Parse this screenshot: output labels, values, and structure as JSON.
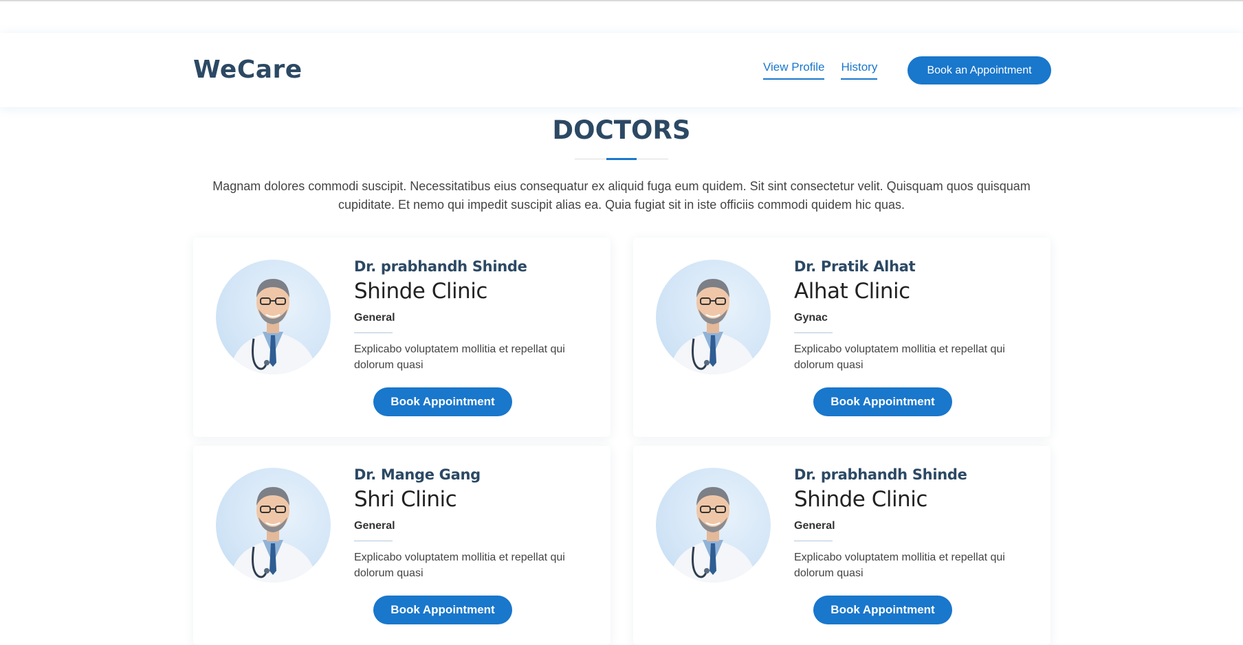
{
  "header": {
    "logo": "WeCare",
    "nav": [
      "View Profile",
      "History"
    ],
    "cta": "Book an Appointment"
  },
  "section": {
    "title": "DOCTORS",
    "description": "Magnam dolores commodi suscipit. Necessitatibus eius consequatur ex aliquid fuga eum quidem. Sit sint consectetur velit. Quisquam quos quisquam cupiditate. Et nemo qui impedit suscipit alias ea. Quia fugiat sit in iste officiis commodi quidem hic quas."
  },
  "doctors": [
    {
      "name": "Dr. prabhandh Shinde",
      "clinic": "Shinde Clinic",
      "specialty": "General",
      "description": "Explicabo voluptatem mollitia et repellat qui dolorum quasi",
      "button": "Book Appointment"
    },
    {
      "name": "Dr. Pratik Alhat",
      "clinic": "Alhat Clinic",
      "specialty": "Gynac",
      "description": "Explicabo voluptatem mollitia et repellat qui dolorum quasi",
      "button": "Book Appointment"
    },
    {
      "name": "Dr. Mange Gang",
      "clinic": "Shri Clinic",
      "specialty": "General",
      "description": "Explicabo voluptatem mollitia et repellat qui dolorum quasi",
      "button": "Book Appointment"
    },
    {
      "name": "Dr. prabhandh Shinde",
      "clinic": "Shinde Clinic",
      "specialty": "General",
      "description": "Explicabo voluptatem mollitia et repellat qui dolorum quasi",
      "button": "Book Appointment"
    }
  ],
  "colors": {
    "accent": "#1977cc",
    "heading": "#2c4964"
  },
  "icons": {
    "doctor_photo": "doctor-portrait-icon"
  }
}
